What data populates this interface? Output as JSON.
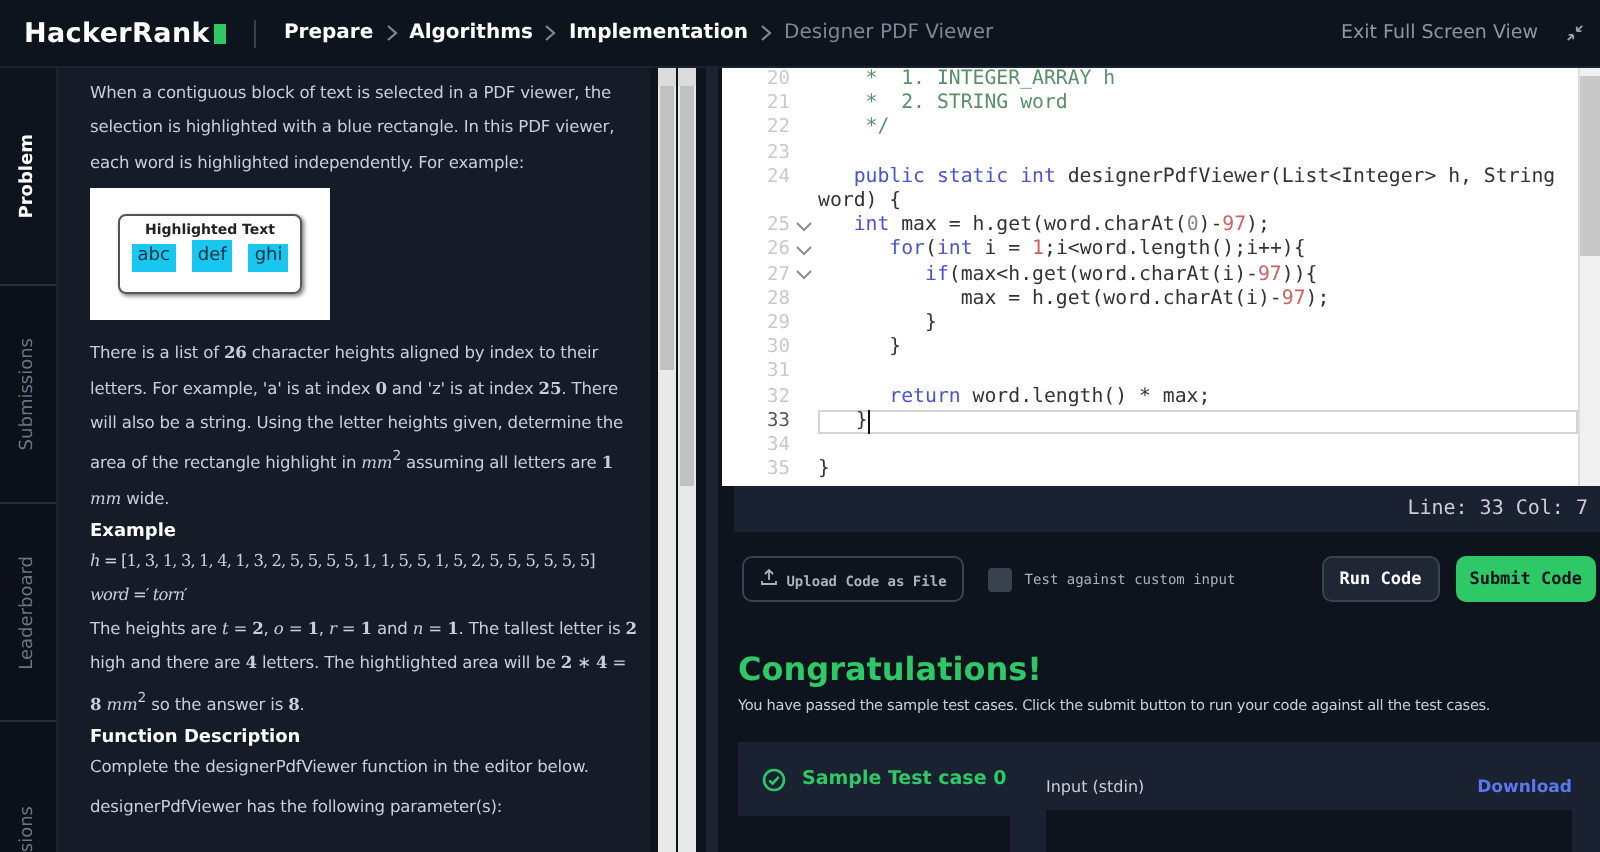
{
  "header": {
    "logo": "HackerRank",
    "breadcrumbs": [
      {
        "label": "Prepare",
        "current": false
      },
      {
        "label": "Algorithms",
        "current": false
      },
      {
        "label": "Implementation",
        "current": false
      },
      {
        "label": "Designer PDF Viewer",
        "current": true
      }
    ],
    "exit_link": "Exit Full Screen View"
  },
  "side_tabs": [
    {
      "label": "Problem",
      "selected": true
    },
    {
      "label": "Submissions",
      "selected": false
    },
    {
      "label": "Leaderboard",
      "selected": false
    },
    {
      "label": "sions",
      "selected": false
    }
  ],
  "problem": [
    {
      "kind": "para",
      "text": "When a contiguous block of text is selected in a PDF viewer, the selection is highlighted with a blue rectangle. In this PDF viewer, each word is highlighted independently. For example:"
    },
    {
      "kind": "figure",
      "title": "Highlighted Text",
      "words": [
        "abc",
        "def",
        "ghi"
      ]
    },
    {
      "kind": "para",
      "text": "There is a list of **26** character heights aligned by index to their letters. For example, 'a' is at index **0** and 'z' is at index **25**. There will also be a string. Using the letter heights given, determine the area of the rectangle highlight in *mm*$^{2}$ assuming all letters are **1** *mm* wide."
    },
    {
      "kind": "heading",
      "text": "Example"
    },
    {
      "kind": "math",
      "text": "*h* = [1, 3, 1, 3, 1, 4, 1, 3, 2, 5, 5, 5, 5, 1, 1, 5, 5, 1, 5, 2, 5, 5, 5, 5, 5, 5]"
    },
    {
      "kind": "math",
      "text": "*word* =′ *torn*′"
    },
    {
      "kind": "para",
      "text": "The heights are *t* = **2**, *o* = **1**, *r* = **1** and *n* = **1**. The tallest letter is **2** high and there are **4** letters. The hightlighted area will be **2** ∗ **4** = **8** *mm*$^{2}$ so the answer is **8**."
    },
    {
      "kind": "heading",
      "text": "Function Description"
    },
    {
      "kind": "para",
      "text": "Complete the designerPdfViewer function in the editor below."
    },
    {
      "kind": "para",
      "text": "designerPdfViewer has the following parameter(s):"
    }
  ],
  "editor": {
    "lines": [
      {
        "number": "20",
        "fold": false,
        "current": false,
        "segments": [
          {
            "kind": "comment",
            "text": "    *  1. INTEGER_ARRAY h"
          }
        ]
      },
      {
        "number": "21",
        "fold": false,
        "current": false,
        "segments": [
          {
            "kind": "comment",
            "text": "    *  2. STRING word"
          }
        ]
      },
      {
        "number": "22",
        "fold": false,
        "current": false,
        "segments": [
          {
            "kind": "comment",
            "text": "    */"
          }
        ]
      },
      {
        "number": "23",
        "fold": false,
        "current": false
      },
      {
        "number": "24",
        "fold": false,
        "current": false,
        "segments": [
          {
            "kind": "keyword",
            "text": "   public static int"
          },
          {
            "kind": "plain",
            "text": " designerPdfViewer(List<Integer> h, String"
          }
        ]
      },
      {
        "fold": false,
        "current": false,
        "segments": [
          {
            "kind": "plain",
            "text": "word) {"
          }
        ]
      },
      {
        "number": "25",
        "fold": true,
        "current": false,
        "segments": [
          {
            "kind": "keyword",
            "text": "   int"
          },
          {
            "kind": "plain",
            "text": " max = h.get(word.charAt("
          },
          {
            "kind": "zero",
            "text": "0"
          },
          {
            "kind": "plain",
            "text": ")-"
          },
          {
            "kind": "number",
            "text": "97"
          },
          {
            "kind": "plain",
            "text": ");"
          }
        ]
      },
      {
        "number": "26",
        "fold": true,
        "current": false,
        "segments": [
          {
            "kind": "keyword",
            "text": "      for"
          },
          {
            "kind": "plain",
            "text": "("
          },
          {
            "kind": "keyword",
            "text": "int"
          },
          {
            "kind": "plain",
            "text": " i = "
          },
          {
            "kind": "number",
            "text": "1"
          },
          {
            "kind": "plain",
            "text": ";i<word.length();i++){"
          }
        ]
      },
      {
        "number": "27",
        "fold": true,
        "current": false,
        "segments": [
          {
            "kind": "keyword",
            "text": "         if"
          },
          {
            "kind": "plain",
            "text": "(max<h.get(word.charAt(i)-"
          },
          {
            "kind": "number",
            "text": "97"
          },
          {
            "kind": "plain",
            "text": ")){"
          }
        ]
      },
      {
        "number": "28",
        "fold": false,
        "current": false,
        "segments": [
          {
            "kind": "plain",
            "text": "            max = h.get(word.charAt(i)-"
          },
          {
            "kind": "number",
            "text": "97"
          },
          {
            "kind": "plain",
            "text": ");"
          }
        ]
      },
      {
        "number": "29",
        "fold": false,
        "current": false,
        "segments": [
          {
            "kind": "plain",
            "text": "         }"
          }
        ]
      },
      {
        "number": "30",
        "fold": false,
        "current": false,
        "segments": [
          {
            "kind": "plain",
            "text": "      }"
          }
        ]
      },
      {
        "number": "31",
        "fold": false,
        "current": false
      },
      {
        "number": "32",
        "fold": false,
        "current": false,
        "segments": [
          {
            "kind": "keyword",
            "text": "      return"
          },
          {
            "kind": "plain",
            "text": " word.length() * max;"
          }
        ]
      },
      {
        "number": "33",
        "fold": false,
        "current": true,
        "segments": [
          {
            "kind": "plain",
            "text": "   }"
          }
        ]
      },
      {
        "number": "34",
        "fold": false,
        "current": false
      },
      {
        "number": "35",
        "fold": false,
        "current": false,
        "segments": [
          {
            "kind": "plain",
            "text": "}"
          }
        ]
      }
    ],
    "status": "Line: 33 Col: 7"
  },
  "actions": {
    "upload": "Upload Code as File",
    "custom_input": {
      "label": "Test against custom input",
      "checked": false
    },
    "run": "Run Code",
    "submit": "Submit Code"
  },
  "result": {
    "title": "Congratulations!",
    "message": "You have passed the sample test cases. Click the submit button to run your code against all the test cases.",
    "test_case": "Sample Test case 0",
    "input_label": "Input (stdin)",
    "download": "Download"
  }
}
